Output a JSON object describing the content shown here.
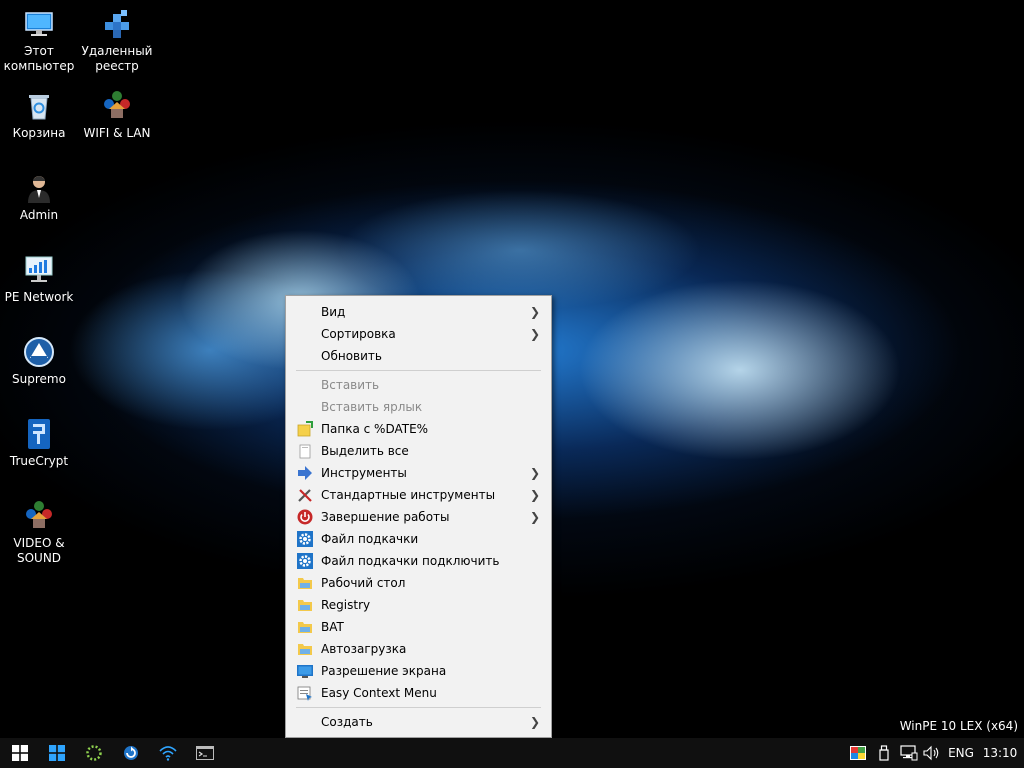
{
  "desktop": {
    "icons": [
      {
        "label": "Этот компьютер",
        "icon": "computer-icon"
      },
      {
        "label": "Удаленный реестр",
        "icon": "remote-registry-icon"
      },
      {
        "label": "Корзина",
        "icon": "recycle-bin-icon"
      },
      {
        "label": "WIFI & LAN",
        "icon": "wifi-lan-icon"
      },
      {
        "label": "Admin",
        "icon": "admin-user-icon"
      },
      {
        "label": "PE Network",
        "icon": "pe-network-icon"
      },
      {
        "label": "Supremo",
        "icon": "supremo-icon"
      },
      {
        "label": "TrueCrypt",
        "icon": "truecrypt-icon"
      },
      {
        "label": "VIDEO & SOUND",
        "icon": "video-sound-icon"
      }
    ],
    "watermark": "WinPE 10 LEX (x64)"
  },
  "context_menu": {
    "items": [
      {
        "label": "Вид",
        "submenu": true,
        "disabled": false,
        "icon": ""
      },
      {
        "label": "Сортировка",
        "submenu": true,
        "disabled": false,
        "icon": ""
      },
      {
        "label": "Обновить",
        "submenu": false,
        "disabled": false,
        "icon": ""
      },
      {
        "label": "Вставить",
        "submenu": false,
        "disabled": true,
        "icon": ""
      },
      {
        "label": "Вставить ярлык",
        "submenu": false,
        "disabled": true,
        "icon": ""
      },
      {
        "label": "Папка с %DATE%",
        "submenu": false,
        "disabled": false,
        "icon": "new-folder-icon"
      },
      {
        "label": "Выделить все",
        "submenu": false,
        "disabled": false,
        "icon": "select-all-icon"
      },
      {
        "label": "Инструменты",
        "submenu": true,
        "disabled": false,
        "icon": "tools-arrow-icon"
      },
      {
        "label": "Стандартные инструменты",
        "submenu": true,
        "disabled": false,
        "icon": "wrench-screwdriver-icon"
      },
      {
        "label": "Завершение работы",
        "submenu": true,
        "disabled": false,
        "icon": "power-icon"
      },
      {
        "label": "Файл подкачки",
        "submenu": false,
        "disabled": false,
        "icon": "gear-icon"
      },
      {
        "label": "Файл подкачки подключить",
        "submenu": false,
        "disabled": false,
        "icon": "gear-icon"
      },
      {
        "label": "Рабочий стол",
        "submenu": false,
        "disabled": false,
        "icon": "folder-icon"
      },
      {
        "label": "Registry",
        "submenu": false,
        "disabled": false,
        "icon": "folder-icon"
      },
      {
        "label": "BAT",
        "submenu": false,
        "disabled": false,
        "icon": "folder-icon"
      },
      {
        "label": "Автозагрузка",
        "submenu": false,
        "disabled": false,
        "icon": "folder-icon"
      },
      {
        "label": "Разрешение экрана",
        "submenu": false,
        "disabled": false,
        "icon": "monitor-icon"
      },
      {
        "label": "Easy Context Menu",
        "submenu": false,
        "disabled": false,
        "icon": "easy-context-menu-icon"
      },
      {
        "label": "Создать",
        "submenu": true,
        "disabled": false,
        "icon": ""
      }
    ]
  },
  "taskbar": {
    "buttons": [
      "start-button-icon",
      "windows-store-icon",
      "loading-circle-icon",
      "refresh-app-icon",
      "wifi-icon",
      "command-prompt-icon"
    ],
    "tray": {
      "language": "ENG",
      "time": "13:10",
      "icons": [
        "color-palette-icon",
        "usb-drive-icon",
        "network-icon",
        "volume-icon"
      ]
    }
  },
  "colors": {
    "menu_bg": "#f2f2f2",
    "taskbar_bg": "#101010",
    "windows_blue": "#2fa5ff",
    "disabled_text": "#8a8a8a"
  }
}
